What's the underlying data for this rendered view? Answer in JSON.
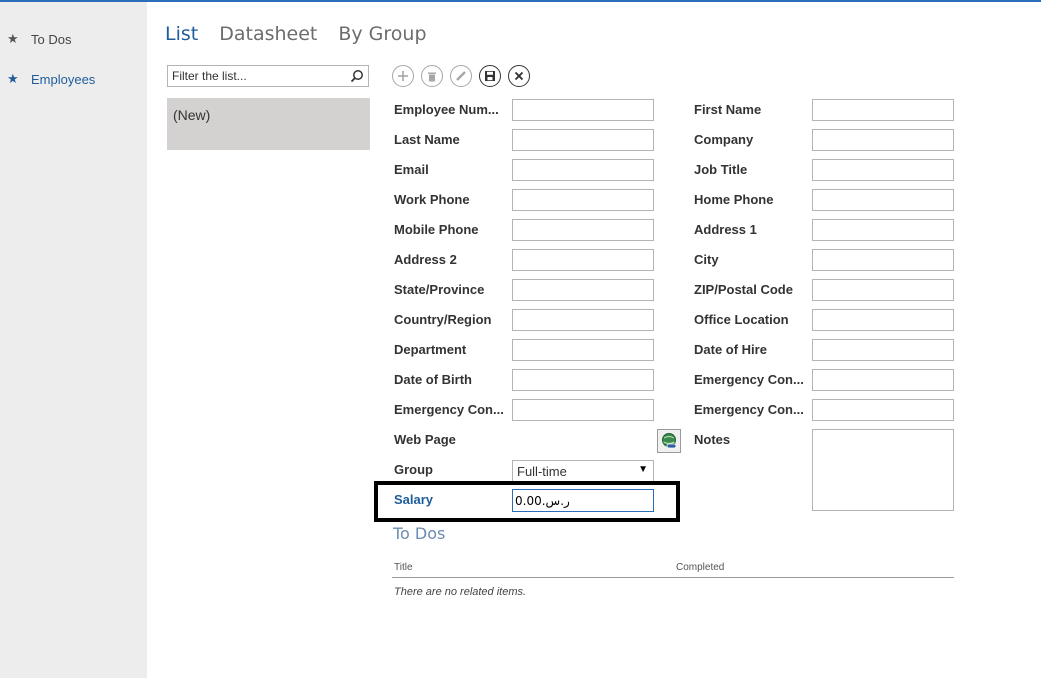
{
  "nav": {
    "items": [
      {
        "label": "To Dos",
        "icon": "star-icon"
      },
      {
        "label": "Employees",
        "icon": "star-icon"
      }
    ]
  },
  "views": {
    "tabs": [
      "List",
      "Datasheet",
      "By Group"
    ],
    "active": "List"
  },
  "filter": {
    "placeholder": "Filter the list...",
    "icon": "search-icon"
  },
  "list": {
    "items": [
      "(New)"
    ]
  },
  "toolbar": {
    "buttons": [
      {
        "name": "add",
        "icon": "plus-icon",
        "enabled": false
      },
      {
        "name": "delete",
        "icon": "trash-icon",
        "enabled": false
      },
      {
        "name": "edit",
        "icon": "pencil-icon",
        "enabled": false
      },
      {
        "name": "save",
        "icon": "save-icon",
        "enabled": true
      },
      {
        "name": "cancel",
        "icon": "close-icon",
        "enabled": true
      }
    ]
  },
  "form": {
    "left_labels": [
      "Employee Num...",
      "Last Name",
      "Email",
      "Work Phone",
      "Mobile Phone",
      "Address 2",
      "State/Province",
      "Country/Region",
      "Department",
      "Date of Birth",
      "Emergency Con...",
      "Web Page",
      "Group",
      "Salary"
    ],
    "right_labels": [
      "First Name",
      "Company",
      "Job Title",
      "Home Phone",
      "Address 1",
      "City",
      "ZIP/Postal Code",
      "Office Location",
      "Date of Hire",
      "Emergency Con...",
      "Emergency Con...",
      "Notes"
    ],
    "group_value": "Full-time",
    "salary_value": "0.00.ر.س"
  },
  "related": {
    "title": "To Dos",
    "columns": [
      "Title",
      "Completed"
    ],
    "empty_message": "There are no related items."
  },
  "colors": {
    "accent": "#1e5d9a",
    "highlight_box": "#000000"
  }
}
